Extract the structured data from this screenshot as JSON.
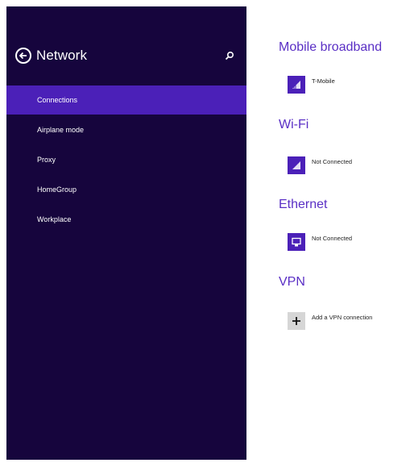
{
  "header": {
    "title": "Network"
  },
  "icons": {
    "back": "back-arrow-icon",
    "search": "search-icon"
  },
  "sidebar": {
    "items": [
      {
        "label": "Connections",
        "active": true
      },
      {
        "label": "Airplane mode",
        "active": false
      },
      {
        "label": "Proxy",
        "active": false
      },
      {
        "label": "HomeGroup",
        "active": false
      },
      {
        "label": "Workplace",
        "active": false
      }
    ]
  },
  "main": {
    "mobile_broadband": {
      "title": "Mobile broadband",
      "items": [
        {
          "label": "T-Mobile",
          "icon": "signal-bars-icon"
        }
      ]
    },
    "wifi": {
      "title": "Wi-Fi",
      "items": [
        {
          "label": "Not Connected",
          "icon": "wifi-signal-icon"
        }
      ]
    },
    "ethernet": {
      "title": "Ethernet",
      "items": [
        {
          "label": "Not Connected",
          "icon": "ethernet-icon"
        }
      ]
    },
    "vpn": {
      "title": "VPN",
      "items": [
        {
          "label": "Add a VPN connection",
          "icon": "plus-icon"
        }
      ]
    }
  },
  "colors": {
    "sidebar_bg": "#16053d",
    "accent": "#4b20b8",
    "section_title": "#5a2fc5"
  }
}
